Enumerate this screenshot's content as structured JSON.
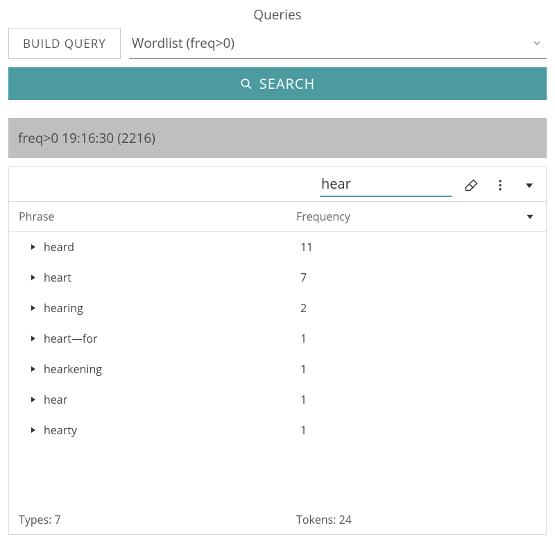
{
  "page_title": "Queries",
  "build_query_label": "BUILD QUERY",
  "wordlist": {
    "selected_label": "Wordlist (freq>0)"
  },
  "search_label": "SEARCH",
  "summary_text": "freq>0 19:16:30 (2216)",
  "filter_value": "hear",
  "columns": {
    "phrase": "Phrase",
    "frequency": "Frequency"
  },
  "rows": [
    {
      "phrase": "heard",
      "frequency": "11"
    },
    {
      "phrase": "heart",
      "frequency": "7"
    },
    {
      "phrase": "hearing",
      "frequency": "2"
    },
    {
      "phrase": "heart—for",
      "frequency": "1"
    },
    {
      "phrase": "hearkening",
      "frequency": "1"
    },
    {
      "phrase": "hear",
      "frequency": "1"
    },
    {
      "phrase": "hearty",
      "frequency": "1"
    }
  ],
  "footer": {
    "types_label": "Types: 7",
    "tokens_label": "Tokens: 24"
  }
}
